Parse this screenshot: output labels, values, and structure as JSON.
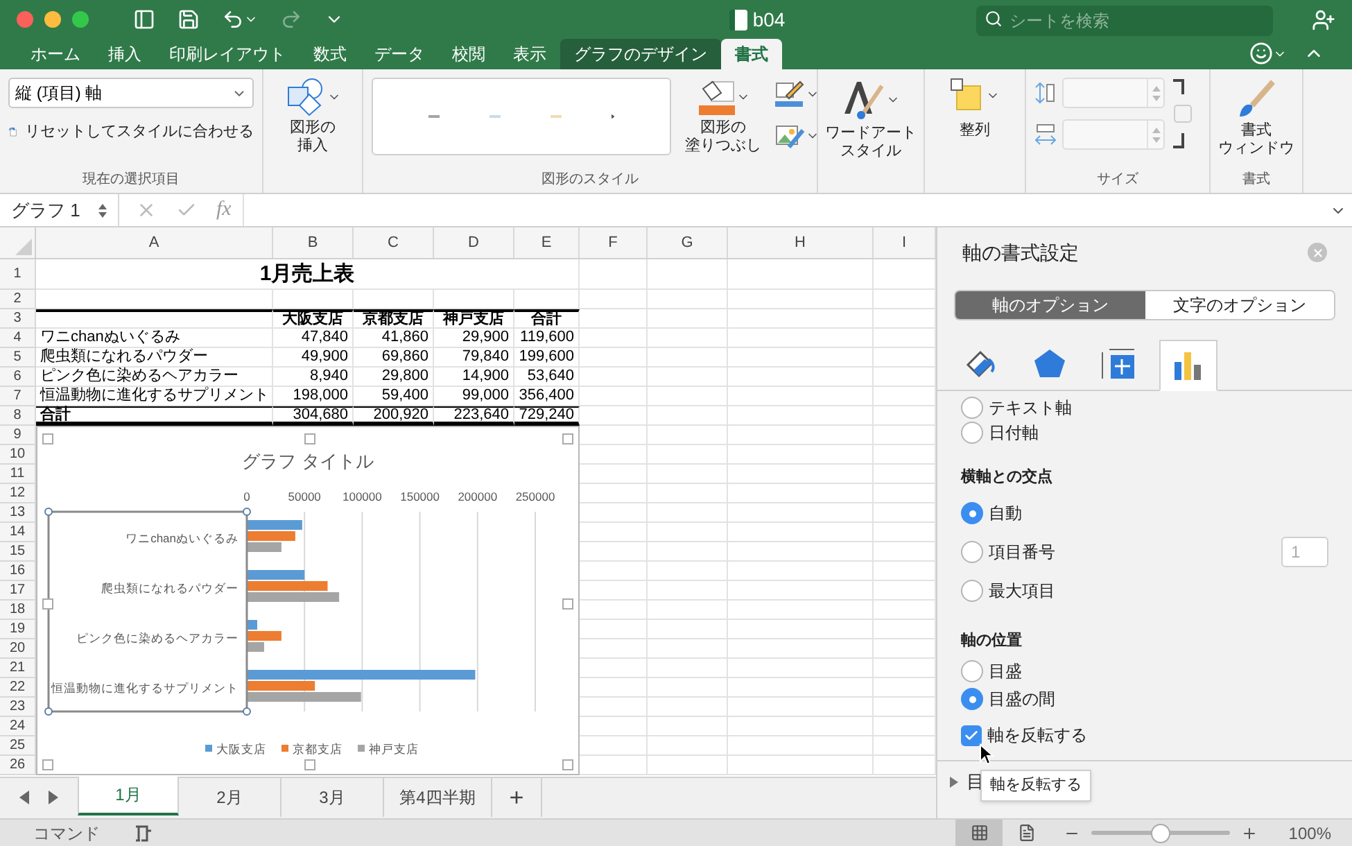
{
  "window": {
    "title": "b04",
    "search": {
      "placeholder": "シートを検索"
    }
  },
  "ribbon_tabs": [
    {
      "label": "ホーム",
      "selected": false,
      "contextual": false
    },
    {
      "label": "挿入",
      "selected": false,
      "contextual": false
    },
    {
      "label": "印刷レイアウト",
      "selected": false,
      "contextual": false
    },
    {
      "label": "数式",
      "selected": false,
      "contextual": false
    },
    {
      "label": "データ",
      "selected": false,
      "contextual": false
    },
    {
      "label": "校閲",
      "selected": false,
      "contextual": false
    },
    {
      "label": "表示",
      "selected": false,
      "contextual": false
    },
    {
      "label": "グラフのデザイン",
      "selected": false,
      "contextual": true
    },
    {
      "label": "書式",
      "selected": true,
      "contextual": true
    }
  ],
  "ribbon": {
    "selection_dropdown": {
      "value": "縦 (項目) 軸"
    },
    "reset_button": "リセットしてスタイルに合わせる",
    "selection_group": "現在の選択項目",
    "insert_shape": [
      "図形の",
      "挿入"
    ],
    "shape_fill": [
      "図形の",
      "塗りつぶし"
    ],
    "shape_styles_group": "図形のスタイル",
    "wordart": [
      "ワードアート",
      "スタイル"
    ],
    "arrange": "整列",
    "size_group": "サイズ",
    "format_window": [
      "書式",
      "ウィンドウ"
    ],
    "format_group": "書式"
  },
  "formula_bar": {
    "name_box": "グラフ 1",
    "function_label": "fx"
  },
  "sheet": {
    "columns": [
      "A",
      "B",
      "C",
      "D",
      "E",
      "F",
      "G",
      "H",
      "I"
    ],
    "row_numbers": [
      "1",
      "2",
      "3",
      "4",
      "5",
      "6",
      "7",
      "8",
      "9",
      "10",
      "11",
      "12",
      "13",
      "14",
      "15",
      "16",
      "17",
      "18",
      "19",
      "20",
      "21",
      "22",
      "23",
      "24",
      "25",
      "26"
    ],
    "title": "1月売上表",
    "header": [
      "大阪支店",
      "京都支店",
      "神戸支店",
      "合計"
    ],
    "rows": [
      {
        "label": "ワニchanぬいぐるみ",
        "values": [
          "47,840",
          "41,860",
          "29,900",
          "119,600"
        ]
      },
      {
        "label": "爬虫類になれるパウダー",
        "values": [
          "49,900",
          "69,860",
          "79,840",
          "199,600"
        ]
      },
      {
        "label": "ピンク色に染めるヘアカラー",
        "values": [
          "8,940",
          "29,800",
          "14,900",
          "53,640"
        ]
      },
      {
        "label": "恒温動物に進化するサプリメント",
        "values": [
          "198,000",
          "59,400",
          "99,000",
          "356,400"
        ]
      }
    ],
    "total": {
      "label": "合計",
      "values": [
        "304,680",
        "200,920",
        "223,640",
        "729,240"
      ]
    },
    "chart": {
      "chart_data": {
        "type": "bar",
        "orientation": "horizontal",
        "title": "グラフ タイトル",
        "categories": [
          "ワニchanぬいぐるみ",
          "爬虫類になれるパウダー",
          "ピンク色に染めるヘアカラー",
          "恒温動物に進化するサプリメント"
        ],
        "series": [
          {
            "name": "大阪支店",
            "color": "#5b9bd5",
            "values": [
              48000,
              50000,
              9000,
              198000
            ]
          },
          {
            "name": "京都支店",
            "color": "#ed7d31",
            "values": [
              42000,
              70000,
              30000,
              59000
            ]
          },
          {
            "name": "神戸支店",
            "color": "#a5a5a5",
            "values": [
              30000,
              80000,
              15000,
              99000
            ]
          }
        ],
        "xlim": [
          0,
          250000
        ],
        "xticks": [
          0,
          50000,
          100000,
          150000,
          200000,
          250000
        ],
        "grid": true,
        "legend": true
      }
    }
  },
  "sheet_tabs": [
    {
      "label": "1月",
      "selected": true
    },
    {
      "label": "2月",
      "selected": false
    },
    {
      "label": "3月",
      "selected": false
    },
    {
      "label": "第4四半期",
      "selected": false
    }
  ],
  "add_sheet": "+",
  "panel": {
    "title": "軸の書式設定",
    "option_tabs": [
      {
        "label": "軸のオプション",
        "selected": true
      },
      {
        "label": "文字のオプション",
        "selected": false
      }
    ],
    "icon_tabs": [
      {
        "kind": "fill",
        "selected": false
      },
      {
        "kind": "effects",
        "selected": false
      },
      {
        "kind": "size",
        "selected": false
      },
      {
        "kind": "options",
        "selected": true
      }
    ],
    "options": [
      {
        "kind": "radio",
        "label": "テキスト軸",
        "selected": false
      },
      {
        "kind": "radio",
        "label": "日付軸",
        "selected": false
      },
      {
        "kind": "heading",
        "label": "横軸との交点"
      },
      {
        "kind": "radio",
        "label": "自動",
        "selected": true
      },
      {
        "kind": "radio",
        "label": "項目番号",
        "selected": false,
        "value": "1"
      },
      {
        "kind": "radio",
        "label": "最大項目",
        "selected": false
      },
      {
        "kind": "heading",
        "label": "軸の位置"
      },
      {
        "kind": "radio",
        "label": "目盛",
        "selected": false
      },
      {
        "kind": "radio",
        "label": "目盛の間",
        "selected": true
      },
      {
        "kind": "checkbox",
        "label": "軸を反転する",
        "checked": true
      }
    ],
    "section": {
      "label": "目",
      "expanded": false
    },
    "tooltip": "軸を反転する"
  },
  "status_bar": {
    "mode": "コマンド",
    "views": [
      {
        "kind": "normal",
        "selected": true
      },
      {
        "kind": "page",
        "selected": false
      }
    ],
    "zoom": {
      "level": 0.5,
      "reading": "100%"
    }
  }
}
